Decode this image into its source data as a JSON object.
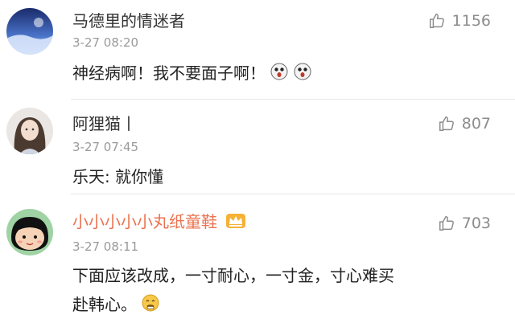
{
  "comments": [
    {
      "user": "马德里的情迷者",
      "time": "3-27 08:20",
      "text": "神经病啊！我不要面子啊！",
      "likes": "1156",
      "emoji": [
        "surprised-face-emoji",
        "surprised-face-emoji"
      ]
    },
    {
      "user": "阿狸猫丨",
      "time": "3-27 07:45",
      "text": "乐天: 就你懂",
      "likes": "807"
    },
    {
      "user": "小小小小小丸纸童鞋",
      "badge": "crown-icon",
      "time": "3-27 08:11",
      "text_line1": "下面应该改成，一寸耐心，一寸金，寸心难买",
      "text_line2": "赴韩心。",
      "likes": "703",
      "emoji": [
        "embarrassed-face-emoji"
      ]
    }
  ],
  "colors": {
    "vip_name": "#eb7350",
    "secondary_text": "#9a9a9a",
    "like_icon": "#8c8c8c"
  }
}
